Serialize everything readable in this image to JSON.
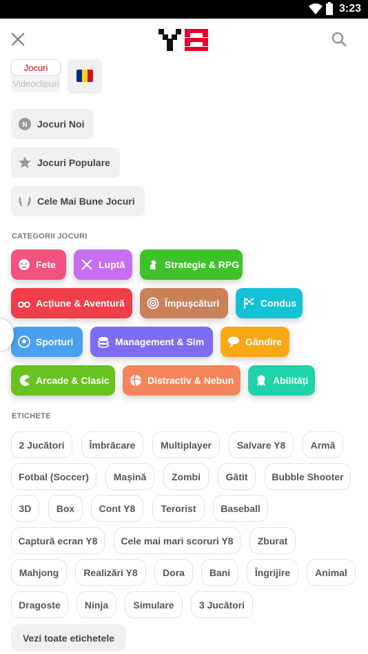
{
  "status_bar": {
    "time": "3:23"
  },
  "header": {
    "close_icon": "close-icon",
    "logo_text": "Y8",
    "search_icon": "search-icon"
  },
  "mode_toggle": {
    "active": "Jocuri",
    "inactive": "Videoclipuri"
  },
  "language": {
    "icon": "romania-flag-icon",
    "colors": [
      "#002B7F",
      "#FCD116",
      "#CE1126"
    ]
  },
  "nav": [
    {
      "label": "Jocuri Noi",
      "icon": "new-badge-icon"
    },
    {
      "label": "Jocuri Populare",
      "icon": "star-icon"
    },
    {
      "label": "Cele Mai Bune Jocuri",
      "icon": "laurel-icon"
    }
  ],
  "categories_title": "CATEGORII JOCURI",
  "categories": [
    {
      "label": "Fete",
      "icon": "girl-face-icon",
      "color": "#f2527d"
    },
    {
      "label": "Luptă",
      "icon": "crossed-swords-icon",
      "color": "#c86ef0"
    },
    {
      "label": "Strategie & RPG",
      "icon": "chess-knight-icon",
      "color": "#3fc12a"
    },
    {
      "label": "Acțiune & Aventură",
      "icon": "binoculars-icon",
      "color": "#f03e4a"
    },
    {
      "label": "Împușcături",
      "icon": "target-icon",
      "color": "#c9815a"
    },
    {
      "label": "Condus",
      "icon": "checkered-flag-icon",
      "color": "#14c2d6"
    },
    {
      "label": "Sporturi",
      "icon": "soccer-ball-icon",
      "color": "#4a9ff0"
    },
    {
      "label": "Management & Sim",
      "icon": "coins-icon",
      "color": "#7c6ef0"
    },
    {
      "label": "Gândire",
      "icon": "thought-bubble-icon",
      "color": "#f8a814"
    },
    {
      "label": "Arcade & Clasic",
      "icon": "pacman-icon",
      "color": "#68c220"
    },
    {
      "label": "Distractiv & Nebun",
      "icon": "beach-ball-icon",
      "color": "#f5845a"
    },
    {
      "label": "Abilități",
      "icon": "medal-icon",
      "color": "#1ed4a8"
    }
  ],
  "tags_title": "ETICHETE",
  "tags": [
    "2 Jucători",
    "Îmbrăcare",
    "Multiplayer",
    "Salvare Y8",
    "Armă",
    "Fotbal (Soccer)",
    "Mașină",
    "Zombi",
    "Gătit",
    "Bubble Shooter",
    "3D",
    "Box",
    "Cont Y8",
    "Terorist",
    "Baseball",
    "Captură ecran Y8",
    "Cele mai mari scoruri Y8",
    "Zburat",
    "Mahjong",
    "Realizări Y8",
    "Dora",
    "Bani",
    "Îngrijire",
    "Animal",
    "Dragoste",
    "Ninja",
    "Simulare",
    "3 Jucători"
  ],
  "see_all_tags": "Vezi toate etichetele"
}
